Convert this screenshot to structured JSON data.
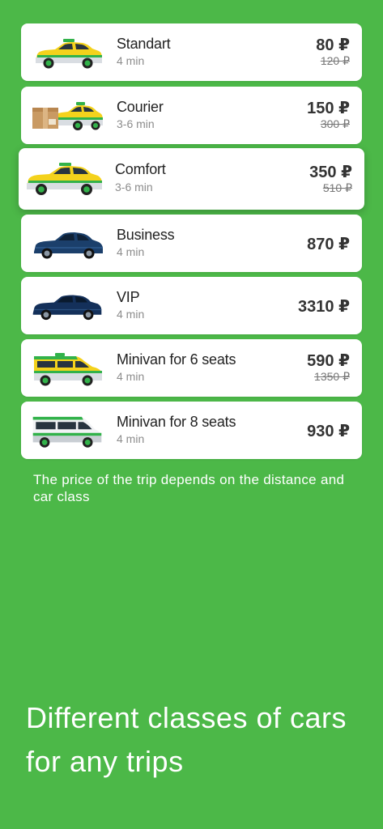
{
  "colors": {
    "background": "#4cb848",
    "card": "#ffffff",
    "taxi_yellow": "#f4d21c",
    "taxi_green": "#32b24a",
    "dark_car": "#1b3f6b"
  },
  "car_classes": [
    {
      "name": "Standart",
      "eta": "4 min",
      "price": "80 ₽",
      "old_price": "120 ₽",
      "icon": "taxi-sedan-icon"
    },
    {
      "name": "Courier",
      "eta": "3-6 min",
      "price": "150 ₽",
      "old_price": "300 ₽",
      "icon": "courier-car-with-box-icon"
    },
    {
      "name": "Comfort",
      "eta": "3-6 min",
      "price": "350 ₽",
      "old_price": "510 ₽",
      "icon": "comfort-taxi-icon",
      "selected": true
    },
    {
      "name": "Business",
      "eta": "4 min",
      "price": "870 ₽",
      "old_price": "",
      "icon": "business-sedan-icon"
    },
    {
      "name": "VIP",
      "eta": "4 min",
      "price": "3310 ₽",
      "old_price": "",
      "icon": "vip-sedan-icon"
    },
    {
      "name": "Minivan for 6 seats",
      "eta": "4 min",
      "price": "590 ₽",
      "old_price": "1350 ₽",
      "icon": "minivan-6-icon"
    },
    {
      "name": "Minivan for 8 seats",
      "eta": "4 min",
      "price": "930 ₽",
      "old_price": "",
      "icon": "minivan-8-icon"
    }
  ],
  "note": "The price of the trip depends on the distance and car class",
  "headline": "Different classes of cars for any trips"
}
